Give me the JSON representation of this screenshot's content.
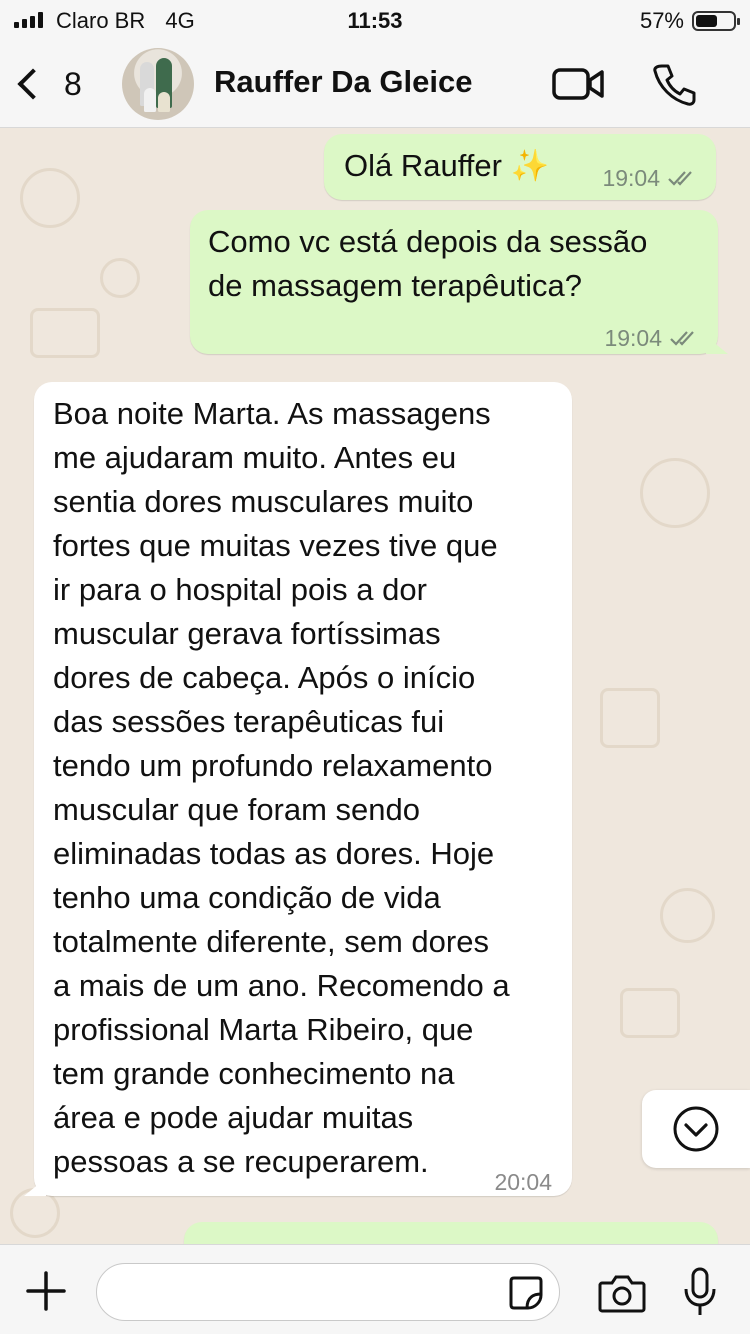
{
  "status_bar": {
    "carrier": "Claro BR",
    "network": "4G",
    "time": "11:53",
    "battery_percent": "57%",
    "battery_level": 0.57
  },
  "header": {
    "back_count": "8",
    "contact_name": "Rauffer Da Gleice",
    "avatar_icon": "contact-photo"
  },
  "messages": [
    {
      "direction": "out",
      "text": "Olá Rauffer ✨",
      "time": "19:04",
      "status": "read"
    },
    {
      "direction": "out",
      "text_lines": [
        "Como vc está depois da sessão",
        "de massagem terapêutica?"
      ],
      "time": "19:04",
      "status": "read"
    },
    {
      "direction": "in",
      "text_lines": [
        "Boa noite Marta. As massagens",
        "me ajudaram muito. Antes eu",
        "sentia dores musculares muito",
        "fortes que muitas vezes tive que",
        "ir para o hospital pois a dor",
        "muscular gerava fortíssimas",
        "dores de cabeça. Após o início",
        "das sessões terapêuticas fui",
        "tendo um profundo relaxamento",
        "muscular que foram sendo",
        "eliminadas todas as dores. Hoje",
        "tenho uma condição de vida",
        "totalmente diferente, sem dores",
        "a mais de um ano. Recomendo a",
        "profissional Marta Ribeiro, que",
        "tem grande conhecimento na",
        "área e pode ajudar muitas",
        "pessoas a se recuperarem."
      ],
      "time": "20:04"
    }
  ],
  "input": {
    "placeholder": "",
    "value": ""
  },
  "icons": {
    "back": "chevron-left-icon",
    "video": "video-camera-icon",
    "phone": "phone-icon",
    "scroll": "chevron-down-circle-icon",
    "plus": "plus-icon",
    "sticker": "sticker-icon",
    "camera": "camera-icon",
    "mic": "microphone-icon"
  },
  "colors": {
    "outgoing_bubble": "#dcf8c6",
    "incoming_bubble": "#ffffff",
    "chat_background": "#efe7dd",
    "bars": "#f6f6f6"
  }
}
